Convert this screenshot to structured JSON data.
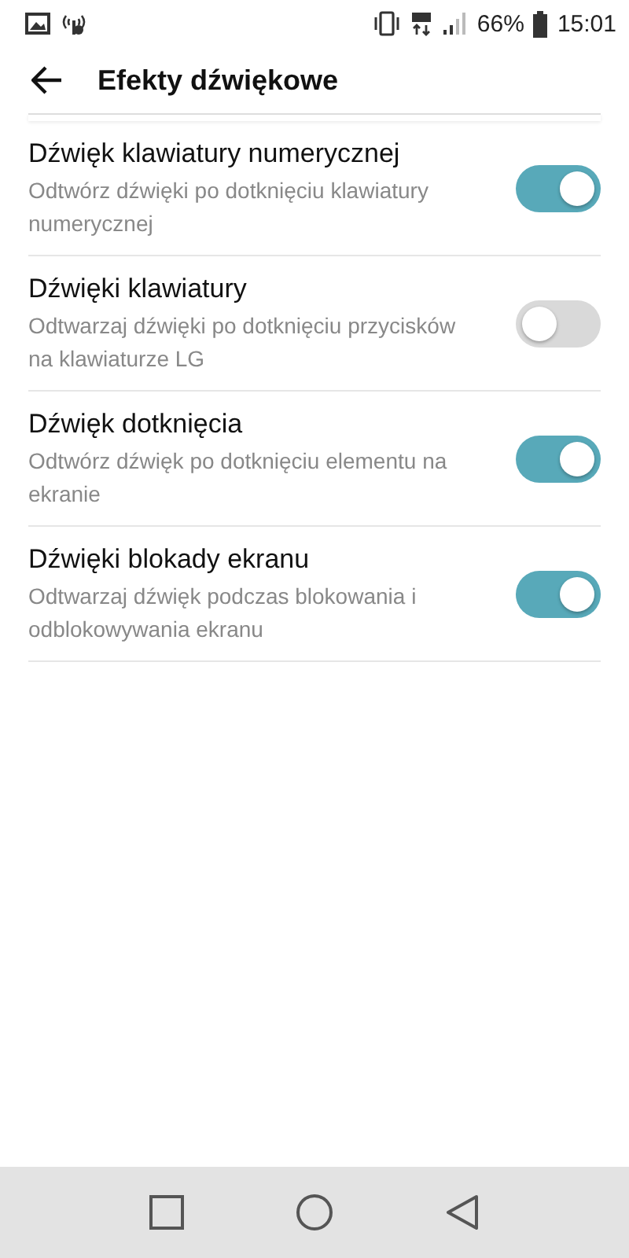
{
  "status_bar": {
    "battery": "66%",
    "time": "15:01"
  },
  "header": {
    "title": "Efekty dźwiękowe"
  },
  "settings": [
    {
      "title": "Dźwięk klawiatury numerycznej",
      "description": "Odtwórz dźwięki po dotknięciu klawiatury numerycznej",
      "on": true
    },
    {
      "title": "Dźwięki klawiatury",
      "description": "Odtwarzaj dźwięki po dotknięciu przycisków na klawiaturze LG",
      "on": false
    },
    {
      "title": "Dźwięk dotknięcia",
      "description": "Odtwórz dźwięk po dotknięciu elementu na ekranie",
      "on": true
    },
    {
      "title": "Dźwięki blokady ekranu",
      "description": "Odtwarzaj dźwięk podczas blokowania i odblokowywania ekranu",
      "on": true
    }
  ]
}
